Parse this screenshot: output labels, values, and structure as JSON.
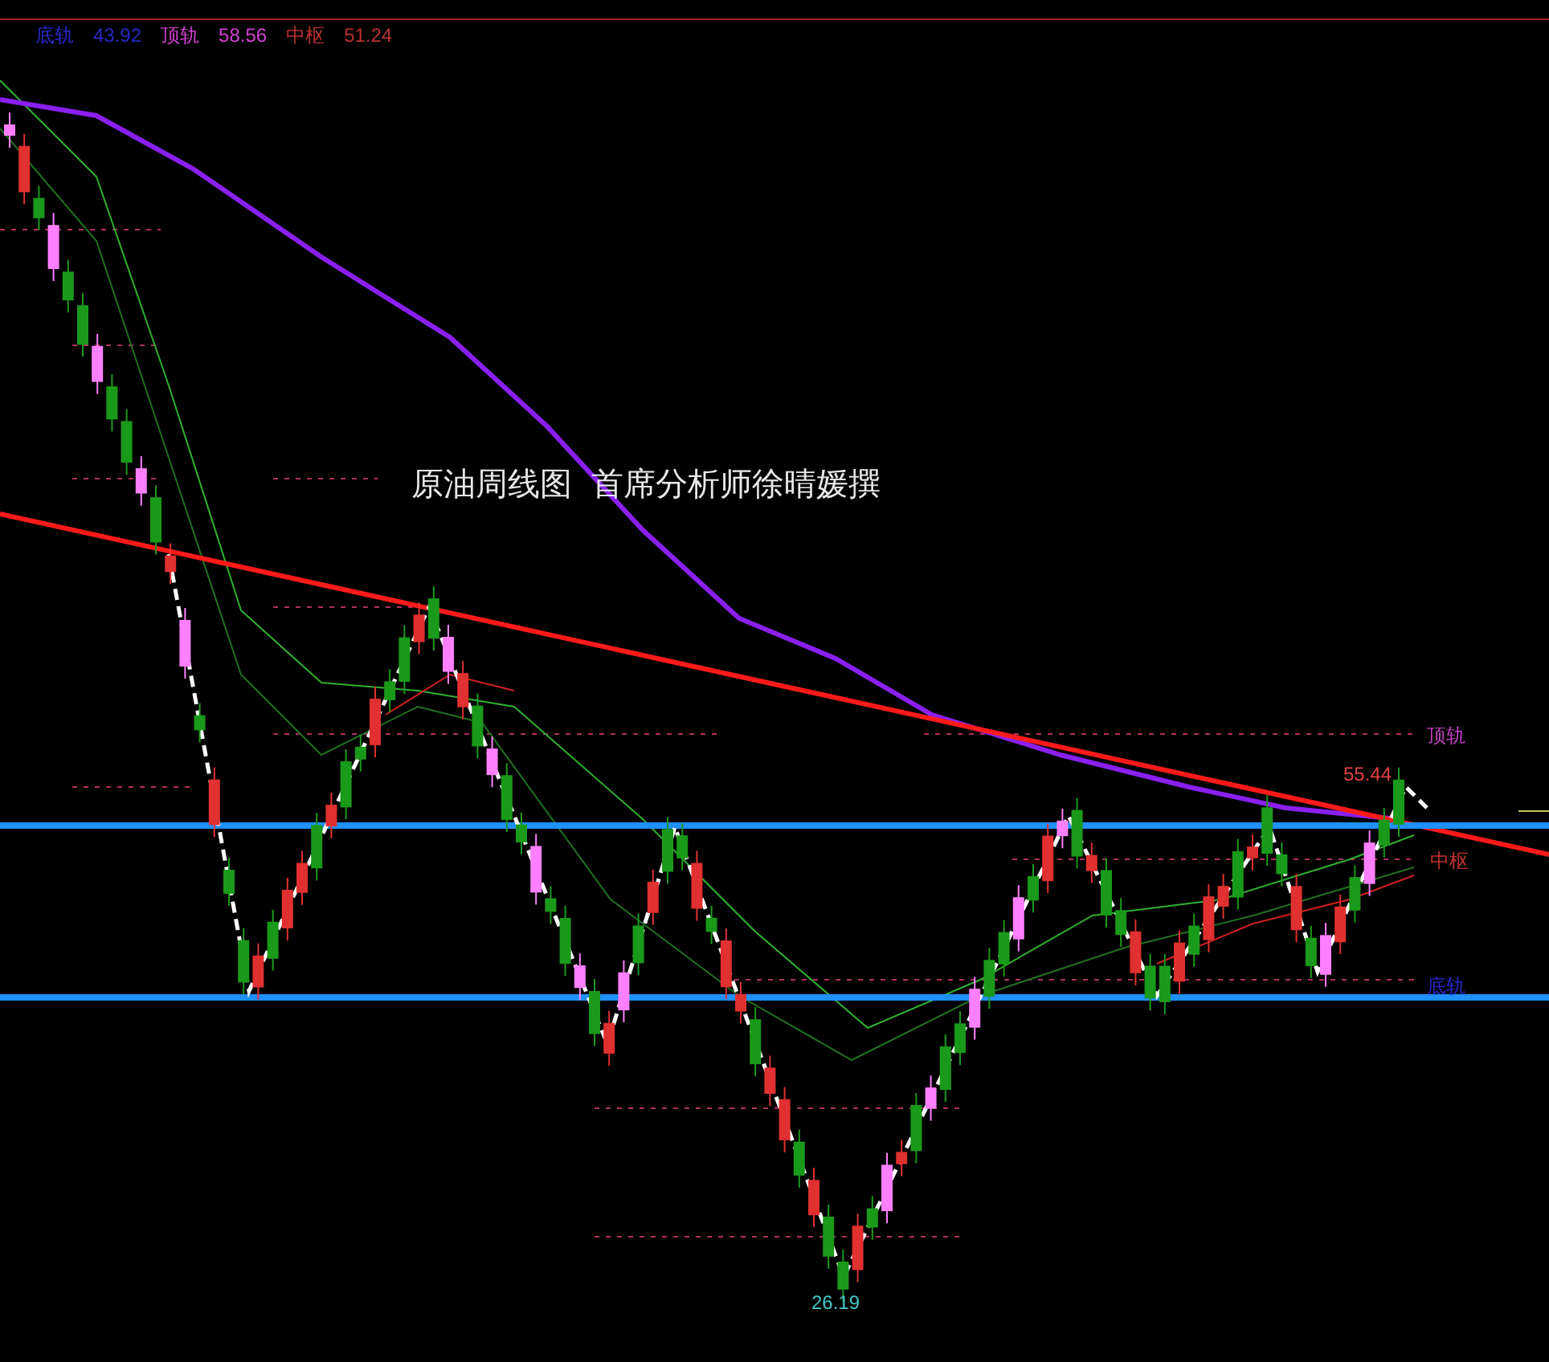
{
  "legend": [
    {
      "label": "底轨",
      "value": "43.92",
      "color": "#2828c8"
    },
    {
      "label": "顶轨",
      "value": "58.56",
      "color": "#d040d0"
    },
    {
      "label": "中枢",
      "value": "51.24",
      "color": "#b83030"
    }
  ],
  "annotation": [
    "原油周线图",
    "首席分析师徐晴媛撰"
  ],
  "band_labels": [
    {
      "label": "顶轨",
      "color": "#c040c0"
    },
    {
      "label": "中枢",
      "color": "#c03030"
    },
    {
      "label": "底轨",
      "color": "#2828c8"
    }
  ],
  "price_labels": [
    {
      "kind": "high",
      "text": "55.44"
    },
    {
      "kind": "low",
      "text": "26.19"
    }
  ]
}
